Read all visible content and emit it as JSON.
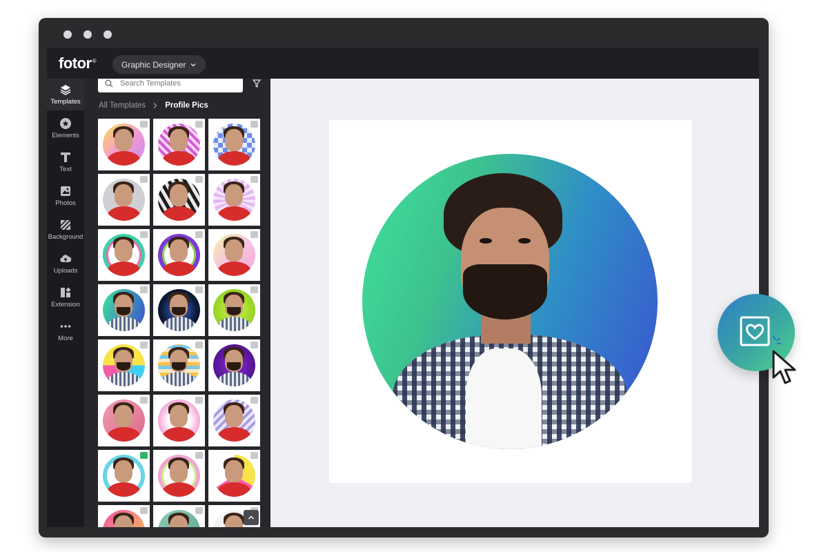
{
  "app": {
    "logo": "fotor",
    "mode_label": "Graphic Designer"
  },
  "rail": {
    "items": [
      {
        "label": "Templates",
        "icon": "layers-icon"
      },
      {
        "label": "Elements",
        "icon": "star-circle-icon"
      },
      {
        "label": "Text",
        "icon": "text-icon"
      },
      {
        "label": "Photos",
        "icon": "image-icon"
      },
      {
        "label": "Background",
        "icon": "background-icon"
      },
      {
        "label": "Uploads",
        "icon": "cloud-upload-icon"
      },
      {
        "label": "Extension",
        "icon": "extension-icon"
      },
      {
        "label": "More",
        "icon": "more-dots-icon"
      }
    ]
  },
  "panel": {
    "search_placeholder": "Search Templates",
    "breadcrumb_root": "All Templates",
    "breadcrumb_current": "Profile Pics"
  },
  "colors": {
    "accent_green": "#3ee39c",
    "accent_blue": "#3b4fd1",
    "app_bg": "#1e1f23"
  }
}
